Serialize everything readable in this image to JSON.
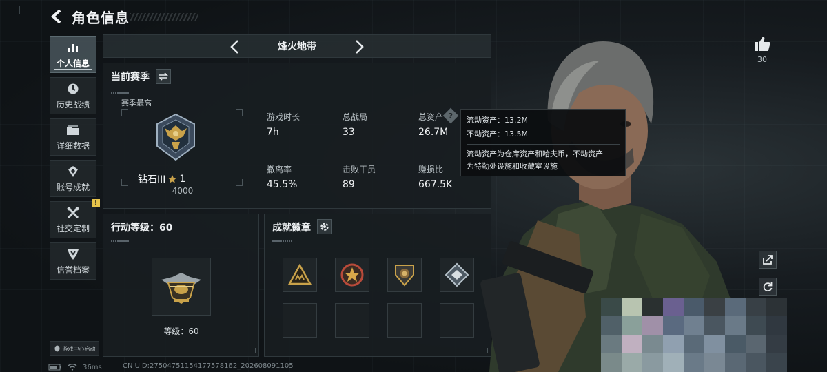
{
  "header": {
    "title": "角色信息"
  },
  "sidebar": {
    "items": [
      {
        "label": "个人信息",
        "icon": "bar-chart-icon",
        "active": true
      },
      {
        "label": "历史战绩",
        "icon": "clock-icon"
      },
      {
        "label": "详细数据",
        "icon": "folder-icon"
      },
      {
        "label": "账号成就",
        "icon": "achievement-icon"
      },
      {
        "label": "社交定制",
        "icon": "tools-icon",
        "badge": "!"
      },
      {
        "label": "信誉档案",
        "icon": "shield-icon"
      }
    ],
    "game_center": "游戏中心启动"
  },
  "mode": {
    "label": "烽火地带"
  },
  "season": {
    "title": "当前赛季",
    "best_label": "赛季最高",
    "rank_name": "钻石III",
    "rank_stars": "1",
    "rank_points": "4000",
    "stats": [
      {
        "label": "游戏时长",
        "value": "7h"
      },
      {
        "label": "总战局",
        "value": "33"
      },
      {
        "label": "总资产",
        "value": "26.7M"
      },
      {
        "label": "撤离率",
        "value": "45.5%"
      },
      {
        "label": "击败干员",
        "value": "89"
      },
      {
        "label": "赚损比",
        "value": "667.5K"
      }
    ]
  },
  "tooltip": {
    "liquid": "流动资产：13.2M",
    "fixed": "不动资产：13.5M",
    "desc_line1": "流动资产为仓库资产和哈夫币，不动资产",
    "desc_line2": "为特勤处设施和收藏室设施"
  },
  "action_level": {
    "title": "行动等级：60",
    "level_text": "等级：60"
  },
  "achievements": {
    "title": "成就徽章",
    "badges": [
      "triangle-squad-badge",
      "star-emblem-badge",
      "lion-shield-badge",
      "diamond-eagle-badge"
    ]
  },
  "likes": {
    "count": "30"
  },
  "status": {
    "ping": "36ms",
    "uid": "CN UID:27504751154177578162_202608091105"
  },
  "colors": {
    "accent": "#c8d0d4",
    "gold": "#c9a24a",
    "warning": "#e6c34a",
    "panel": "#181d21"
  }
}
